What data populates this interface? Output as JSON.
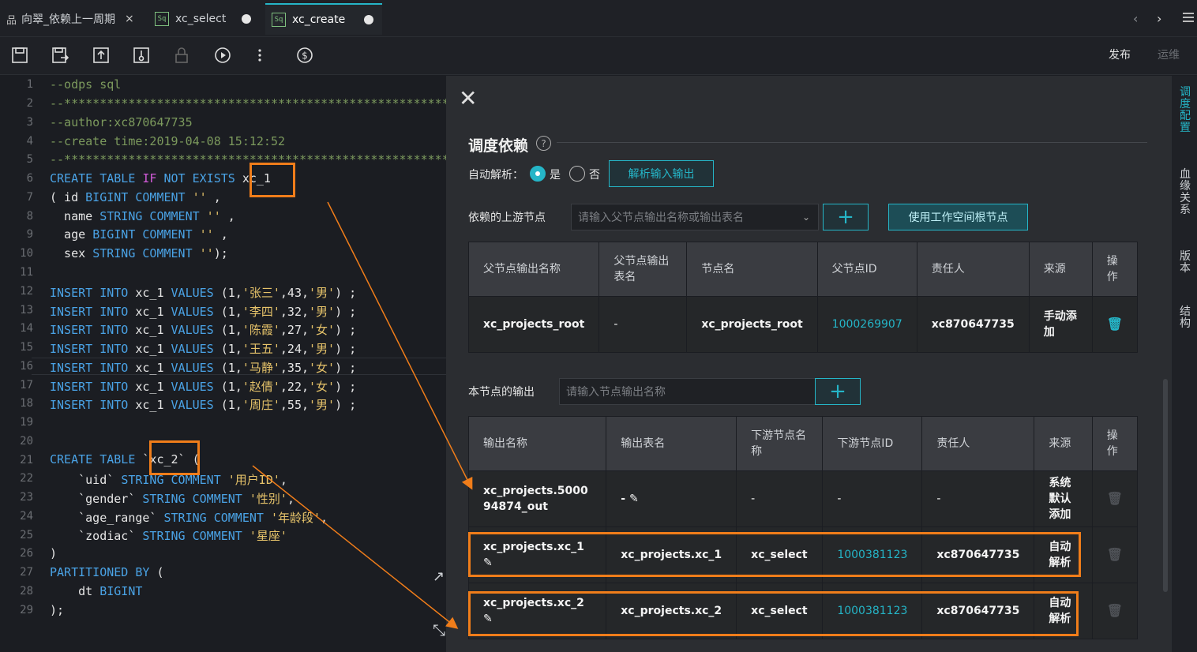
{
  "tabs": [
    {
      "label": "向翠_依赖上一周期",
      "close": "×"
    },
    {
      "label": "xc_select",
      "icon": "Sq"
    },
    {
      "label": "xc_create",
      "icon": "Sq"
    }
  ],
  "toolbar": {
    "publish": "发布",
    "ops": "运维"
  },
  "editor": {
    "line_numbers": [
      "1",
      "2",
      "3",
      "4",
      "5",
      "6",
      "7",
      "8",
      "9",
      "10",
      "11",
      "12",
      "13",
      "14",
      "15",
      "16",
      "17",
      "18",
      "19",
      "20",
      "21",
      "22",
      "23",
      "24",
      "25",
      "26",
      "27",
      "28",
      "29"
    ],
    "lines": {
      "l1": "--odps sql",
      "l2": "--**********************************************************",
      "l3": "--author:xc870647735",
      "l4": "--create time:2019-04-08 15:12:52",
      "l5": "--**********************************************************",
      "l6a": "CREATE TABLE ",
      "l6b": "IF",
      "l6c": " NOT EXISTS ",
      "l6d": "xc_1",
      "l7a": "( id ",
      "l7b": "BIGINT COMMENT",
      "l7c": " ''",
      "l7d": " ,",
      "l8a": "  name ",
      "l8b": "STRING COMMENT",
      "l8c": " ''",
      "l8d": " ,",
      "l9a": "  age ",
      "l9b": "BIGINT COMMENT",
      "l9c": " ''",
      "l9d": " ,",
      "l10a": "  sex ",
      "l10b": "STRING COMMENT",
      "l10c": " ''",
      "l10d": ");",
      "l12a": "INSERT INTO",
      "l12b": " xc_1 ",
      "l12c": "VALUES",
      "l12d": " (1,",
      "l12e": "'张三'",
      "l12f": ",43,",
      "l12g": "'男'",
      "l12h": ") ;",
      "l13e": "'李四'",
      "l13f": ",32,",
      "l13g": "'男'",
      "l14e": "'陈霞'",
      "l14f": ",27,",
      "l14g": "'女'",
      "l15e": "'王五'",
      "l15f": ",24,",
      "l15g": "'男'",
      "l16e": "'马静'",
      "l16f": ",35,",
      "l16g": "'女'",
      "l17e": "'赵倩'",
      "l17f": ",22,",
      "l17g": "'女'",
      "l18e": "'周庄'",
      "l18f": ",55,",
      "l18g": "'男'",
      "l21a": "CREATE TABLE ",
      "l21b": "`xc_2`",
      "l21c": " (",
      "l22a": "    `uid` ",
      "l22b": "STRING COMMENT",
      "l22c": " '用户ID'",
      "l22d": ",",
      "l23a": "    `gender` ",
      "l23b": "STRING COMMENT",
      "l23c": " '性别'",
      "l23d": ",",
      "l24a": "    `age_range` ",
      "l24b": "STRING COMMENT",
      "l24c": " '年龄段'",
      "l24d": ",",
      "l25a": "    `zodiac` ",
      "l25b": "STRING COMMENT",
      "l25c": " '星座'",
      "l26": ")",
      "l27a": "PARTITIONED BY",
      "l27b": " (",
      "l28a": "    dt ",
      "l28b": "BIGINT",
      "l29": ");"
    }
  },
  "panel": {
    "title": "调度依赖",
    "auto_parse_label": "自动解析：",
    "yes": "是",
    "no": "否",
    "parse_btn": "解析输入输出",
    "upstream_label": "依赖的上游节点",
    "upstream_placeholder": "请输入父节点输出名称或输出表名",
    "root_btn": "使用工作空间根节点",
    "upstream_table": {
      "headers": [
        "父节点输出名称",
        "父节点输出表名",
        "节点名",
        "父节点ID",
        "责任人",
        "来源",
        "操作"
      ],
      "rows": [
        [
          "xc_projects_root",
          "-",
          "xc_projects_root",
          "1000269907",
          "xc870647735",
          "手动添加"
        ]
      ]
    },
    "output_label": "本节点的输出",
    "output_placeholder": "请输入节点输出名称",
    "output_table": {
      "headers": [
        "输出名称",
        "输出表名",
        "下游节点名称",
        "下游节点ID",
        "责任人",
        "来源",
        "操作"
      ],
      "rows": [
        [
          "xc_projects.500094874_out",
          "-",
          "-",
          "-",
          "-",
          "系统默认添加"
        ],
        [
          "xc_projects.xc_1",
          "xc_projects.xc_1",
          "xc_select",
          "1000381123",
          "xc870647735",
          "自动解析"
        ],
        [
          "xc_projects.xc_2",
          "xc_projects.xc_2",
          "xc_select",
          "1000381123",
          "xc870647735",
          "自动解析"
        ]
      ]
    }
  },
  "sidebar": [
    "调度配置",
    "血缘关系",
    "版本",
    "结构"
  ],
  "colors": {
    "accent": "#25b5c7",
    "highlight": "#f07d1a"
  }
}
